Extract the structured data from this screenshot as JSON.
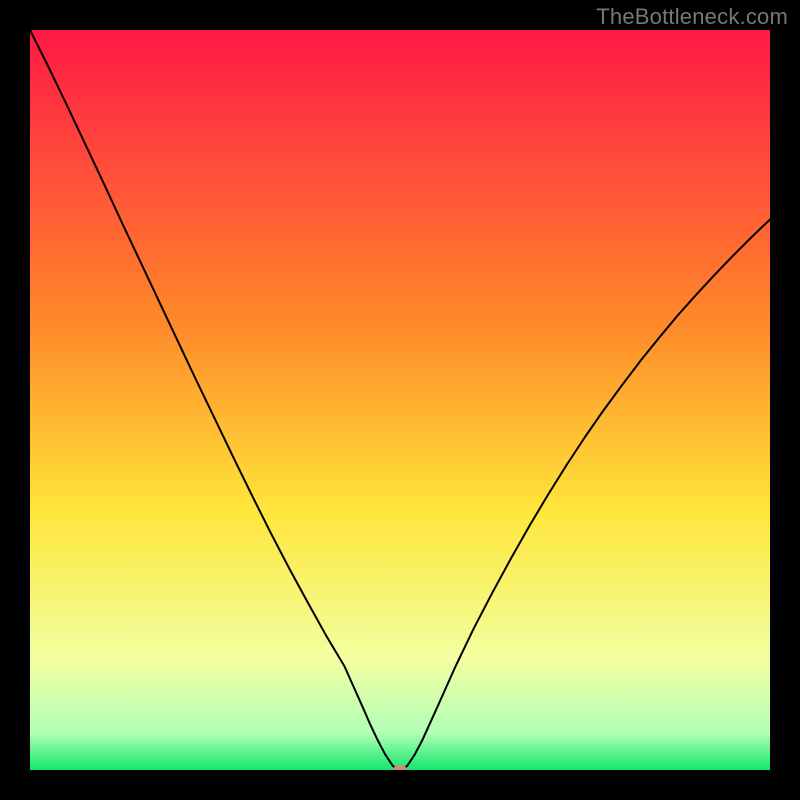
{
  "watermark": "TheBottleneck.com",
  "chart_data": {
    "type": "line",
    "title": "",
    "xlabel": "",
    "ylabel": "",
    "xlim": [
      0,
      100
    ],
    "ylim": [
      0,
      100
    ],
    "grid": false,
    "legend": false,
    "gradient_stops": [
      {
        "offset": 0,
        "color": "#ff1846"
      },
      {
        "offset": 40,
        "color": "#ff8a2a"
      },
      {
        "offset": 65,
        "color": "#ffe63a"
      },
      {
        "offset": 85,
        "color": "#f3ffa0"
      },
      {
        "offset": 95,
        "color": "#b2ffb5"
      },
      {
        "offset": 100,
        "color": "#12e86d"
      }
    ],
    "curve": {
      "color": "#000000",
      "stroke_width": 2,
      "x": [
        0,
        2.5,
        5,
        7.5,
        10,
        12.5,
        15,
        17.5,
        20,
        22.5,
        25,
        27.5,
        30,
        32.5,
        35,
        37.5,
        40,
        42.5,
        45,
        46,
        47,
        48,
        49,
        49.5,
        50,
        50.5,
        51,
        52,
        53,
        55,
        57.5,
        60,
        62.5,
        65,
        67.5,
        70,
        72.5,
        75,
        77.5,
        80,
        82.5,
        85,
        87.5,
        90,
        92.5,
        95,
        97.5,
        100
      ],
      "y": [
        100,
        95,
        89.8,
        84.5,
        79.2,
        73.8,
        68.5,
        63.2,
        57.9,
        52.6,
        47.4,
        42.2,
        37.1,
        32.1,
        27.3,
        22.7,
        18.2,
        14,
        8.4,
        6.1,
        4,
        2.1,
        0.6,
        0.15,
        0,
        0.15,
        0.6,
        2.1,
        4,
        8.4,
        14,
        19.2,
        24,
        28.6,
        33,
        37.2,
        41.2,
        45,
        48.6,
        52,
        55.3,
        58.4,
        61.4,
        64.2,
        66.9,
        69.5,
        72,
        74.4
      ]
    },
    "marker": {
      "x": 50,
      "y": 0,
      "rx": 7,
      "ry": 5,
      "fill": "#d78a7b"
    }
  }
}
